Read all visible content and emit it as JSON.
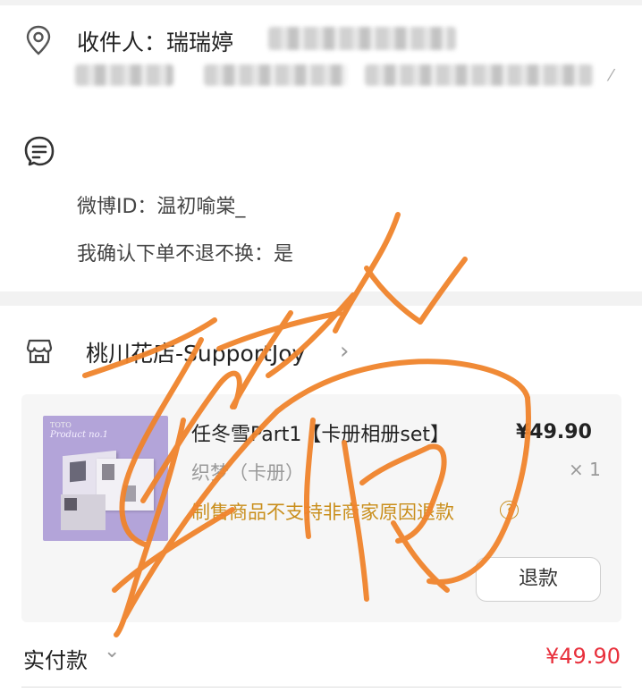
{
  "address": {
    "recipient_label": "收件人：瑞瑞婷",
    "icon": "location-pin-icon"
  },
  "remark": {
    "icon": "note-icon",
    "weibo_id": "微博ID：温初喻棠_",
    "confirm": "我确认下单不退不换：是"
  },
  "shop": {
    "icon": "shop-icon",
    "name": "桃川花店-SupportJoy",
    "chevron": "chevron-right-icon"
  },
  "product": {
    "thumb_top": "TOTO",
    "thumb_brand": "Product no.1",
    "title": "任冬雪Part1【卡册相册set】",
    "price": "¥49.90",
    "variant": "织梦（卡册）",
    "quantity": "× 1",
    "notice": "制售商品不支持非商家原因退款",
    "help_icon": "question-circle-icon",
    "refund_button": "退款"
  },
  "payment": {
    "label": "实付款",
    "amount": "¥49.90",
    "chevron": "chevron-down-icon"
  },
  "colors": {
    "accent_red": "#e8303c",
    "notice_gold": "#c98e1b",
    "signature_orange": "#f0842c"
  }
}
